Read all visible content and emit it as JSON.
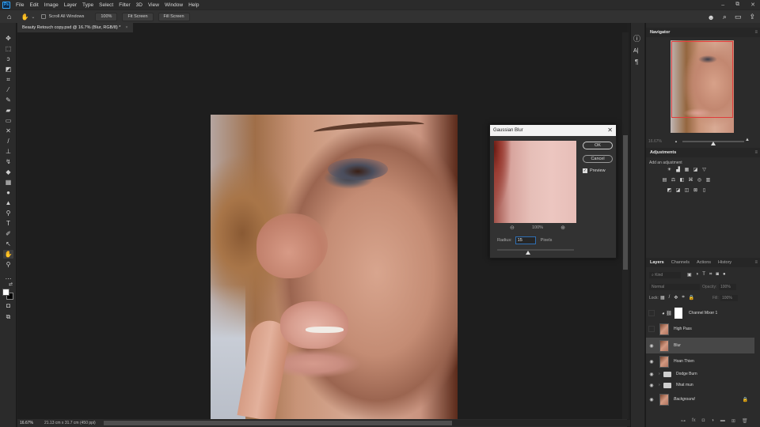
{
  "app": {
    "logo": "Ps"
  },
  "menu": [
    "File",
    "Edit",
    "Image",
    "Layer",
    "Type",
    "Select",
    "Filter",
    "3D",
    "View",
    "Window",
    "Help"
  ],
  "window_controls": {
    "minimize": "–",
    "restore": "⧉",
    "close": "✕"
  },
  "options_bar": {
    "home_icon": "⌂",
    "hand_icon": "✋",
    "dropdown_icon": "⌄",
    "scroll_all_windows_label": "Scroll All Windows",
    "zoom_100_label": "100%",
    "fit_screen_label": "Fit Screen",
    "fill_screen_label": "Fill Screen",
    "right_icons": {
      "user": "☻",
      "search": "⌕",
      "workspace": "▭",
      "share": "⇪"
    }
  },
  "document_tab": {
    "title": "Beauty Retouch copy.psd @ 16.7% (Blur, RGB/8) *",
    "close": "×"
  },
  "tools": [
    {
      "name": "move-tool",
      "glyph": "✥"
    },
    {
      "name": "marquee-tool",
      "glyph": "⬚"
    },
    {
      "name": "lasso-tool",
      "glyph": "ↄ"
    },
    {
      "name": "object-selection-tool",
      "glyph": "◩"
    },
    {
      "name": "crop-tool",
      "glyph": "⌗"
    },
    {
      "name": "eyedropper-tool",
      "glyph": "⁄"
    },
    {
      "name": "healing-brush-tool",
      "glyph": "✎"
    },
    {
      "name": "patch-tool",
      "glyph": "▰"
    },
    {
      "name": "frame-tool",
      "glyph": "▭"
    },
    {
      "name": "content-aware-move-tool",
      "glyph": "✕"
    },
    {
      "name": "brush-tool",
      "glyph": "/"
    },
    {
      "name": "clone-stamp-tool",
      "glyph": "⊥"
    },
    {
      "name": "history-brush-tool",
      "glyph": "↯"
    },
    {
      "name": "eraser-tool",
      "glyph": "◆"
    },
    {
      "name": "gradient-tool",
      "glyph": "▦"
    },
    {
      "name": "blur-tool",
      "glyph": "●"
    },
    {
      "name": "dodge-tool",
      "glyph": "▲"
    },
    {
      "name": "pen-tool",
      "glyph": "⚲"
    },
    {
      "name": "type-tool",
      "glyph": "T"
    },
    {
      "name": "path-selection-tool",
      "glyph": "✐"
    },
    {
      "name": "direct-selection-tool",
      "glyph": "↖"
    },
    {
      "name": "hand-tool",
      "glyph": "✋"
    },
    {
      "name": "zoom-tool",
      "glyph": "⚲"
    },
    {
      "name": "more-tools",
      "glyph": "⋯"
    },
    {
      "name": "swap-colors",
      "glyph": "⇄"
    },
    {
      "name": "quick-mask",
      "glyph": "◘"
    },
    {
      "name": "screen-mode",
      "glyph": "⧉"
    }
  ],
  "colors": {
    "foreground": "#ffffff",
    "background": "#000000",
    "accent": "#31a8ff",
    "nav_frame": "#e03b3b"
  },
  "status_bar": {
    "zoom": "16.67%",
    "doc_info": "21.13 cm x 31.7 cm (450 ppi)",
    "arrow_right": "›",
    "arrow_left": "‹"
  },
  "icon_strip": {
    "info": "ⓘ",
    "character": "A|",
    "paragraph": "¶"
  },
  "navigator": {
    "title": "Navigator",
    "zoom": "16.67%",
    "menu": "≡",
    "zoom_out_icon": "▲",
    "zoom_in_icon": "▲",
    "zoom_slider": 0.5
  },
  "adjustments": {
    "title": "Adjustments",
    "subtitle": "Add an adjustment",
    "row1": [
      "☀",
      "▟",
      "▦",
      "◪",
      "▽"
    ],
    "row2": [
      "▤",
      "⚖",
      "◧",
      "⌘",
      "◎",
      "▥"
    ],
    "row3": [
      "◩",
      "◪",
      "◫",
      "⊠",
      "▯"
    ]
  },
  "layers_panel": {
    "tabs": [
      "Layers",
      "Channels",
      "Actions",
      "History"
    ],
    "filter_placeholder": "Kind",
    "filter_icons": [
      "▣",
      "◑",
      "T",
      "⌗",
      "◙",
      "●"
    ],
    "blend_mode": "Normal",
    "opacity_label": "Opacity:",
    "opacity_value": "100%",
    "lock_label": "Lock:",
    "lock_icons": [
      "▦",
      "/",
      "✥",
      "⌗",
      "🔒"
    ],
    "fill_label": "Fill:",
    "fill_value": "100%",
    "layers": [
      {
        "name": "Channel Mixer 1",
        "visible": false,
        "type": "adjustment"
      },
      {
        "name": "High Pass",
        "visible": false,
        "type": "pixel"
      },
      {
        "name": "Blur",
        "visible": true,
        "type": "pixel",
        "selected": true
      },
      {
        "name": "Hoan Thien",
        "visible": true,
        "type": "pixel"
      },
      {
        "name": "Dodge Burn",
        "visible": true,
        "type": "group"
      },
      {
        "name": "Nhat mun",
        "visible": true,
        "type": "group"
      },
      {
        "name": "Background",
        "visible": true,
        "type": "pixel",
        "locked": true
      }
    ],
    "footer_icons": [
      "⊶",
      "fx",
      "◘",
      "◑",
      "▬",
      "⊞",
      "🗑"
    ]
  },
  "gaussian_blur": {
    "title": "Gaussian Blur",
    "close": "✕",
    "ok_label": "OK",
    "cancel_label": "Cancel",
    "preview_label": "Preview",
    "preview_checked": true,
    "zoom_out_icon": "⊖",
    "zoom_in_icon": "⊕",
    "zoom_level": "100%",
    "radius_label": "Radius:",
    "radius_value": "15",
    "radius_unit": "Pixels",
    "radius_slider": 0.4
  }
}
